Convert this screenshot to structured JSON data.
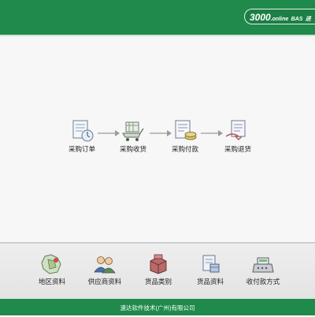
{
  "header": {
    "brand_main": "3000",
    "brand_sub": ".online",
    "brand_bas": "BAS",
    "brand_extra": "进"
  },
  "flow": {
    "items": [
      {
        "label": "采购订单",
        "icon": "purchase-order-icon"
      },
      {
        "label": "采购收货",
        "icon": "purchase-receiving-icon"
      },
      {
        "label": "采购付款",
        "icon": "purchase-payment-icon"
      },
      {
        "label": "采购退货",
        "icon": "purchase-return-icon"
      }
    ]
  },
  "bottom": {
    "items": [
      {
        "label": "地区资料",
        "icon": "region-data-icon"
      },
      {
        "label": "供应商资料",
        "icon": "supplier-data-icon"
      },
      {
        "label": "货品类别",
        "icon": "goods-category-icon"
      },
      {
        "label": "货品资料",
        "icon": "goods-data-icon"
      },
      {
        "label": "收付款方式",
        "icon": "payment-method-icon"
      }
    ]
  },
  "footer": {
    "text": "速达软件技术(广州)有限公司"
  },
  "colors": {
    "brand_green": "#1f8a4c"
  }
}
